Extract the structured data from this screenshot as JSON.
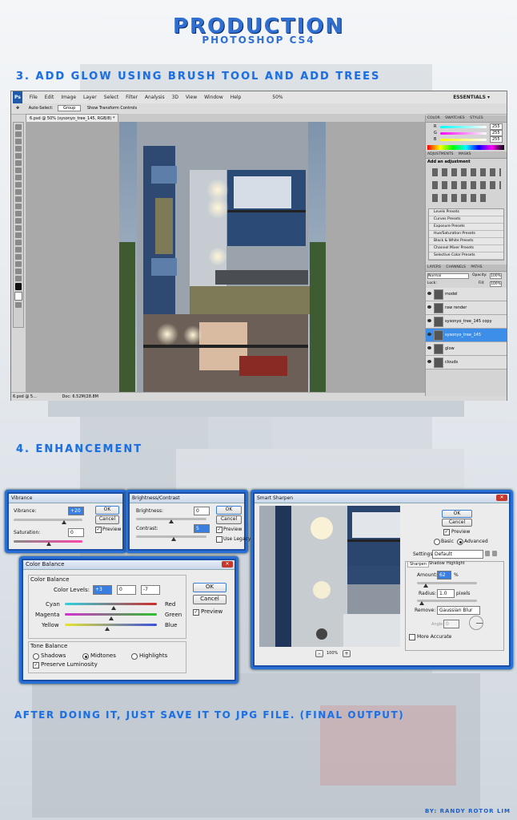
{
  "header": {
    "title": "PRODUCTION",
    "subtitle": "PHOTOSHOP CS4"
  },
  "steps": {
    "step3": "3. ADD GLOW USING BRUSH TOOL AND ADD TREES",
    "step4": "4. ENHANCEMENT",
    "final": "AFTER DOING IT, JUST SAVE IT TO JPG FILE. (FINAL OUTPUT)",
    "credit": "BY: RANDY ROTOR LIM"
  },
  "photoshop": {
    "logo": "Ps",
    "menu": [
      "File",
      "Edit",
      "Image",
      "Layer",
      "Select",
      "Filter",
      "Analysis",
      "3D",
      "View",
      "Window",
      "Help"
    ],
    "zoom": "50%",
    "workspace": "ESSENTIALS ▾",
    "options": {
      "auto_select": "Auto-Select:",
      "group": "Group",
      "transform": "Show Transform Controls"
    },
    "doc_tab": "6.psd @ 50% (sysonyo_tree_145, RGB/8) *",
    "status_left": "6.psd @ 5...",
    "status_doc": "Doc: 6.52M/28.8M",
    "color_panel": {
      "tabs": [
        "COLOR",
        "SWATCHES",
        "STYLES"
      ],
      "r_label": "R",
      "g_label": "G",
      "b_label": "B",
      "r": "255",
      "g": "255",
      "b": "255"
    },
    "adjustments": {
      "tabs": [
        "ADJUSTMENTS",
        "MASKS"
      ],
      "heading": "Add an adjustment",
      "presets": [
        "Levels Presets",
        "Curves Presets",
        "Exposure Presets",
        "Hue/Saturation Presets",
        "Black & White Presets",
        "Channel Mixer Presets",
        "Selective Color Presets"
      ]
    },
    "layers": {
      "tabs": [
        "LAYERS",
        "CHANNELS",
        "PATHS"
      ],
      "blend": "Normal",
      "opacity_label": "Opacity:",
      "opacity": "100%",
      "lock_label": "Lock:",
      "fill_label": "Fill:",
      "fill": "100%",
      "items": [
        {
          "name": "model",
          "selected": false
        },
        {
          "name": "raw render",
          "selected": false
        },
        {
          "name": "sysonyo_tree_145 copy",
          "selected": false
        },
        {
          "name": "sysonyo_tree_145",
          "selected": true
        },
        {
          "name": "glow",
          "selected": false
        },
        {
          "name": "clouds",
          "selected": false
        }
      ]
    }
  },
  "vibrance": {
    "title": "Vibrance",
    "vibrance_label": "Vibrance:",
    "vibrance_value": "+20",
    "saturation_label": "Saturation:",
    "saturation_value": "0",
    "ok": "OK",
    "cancel": "Cancel",
    "preview": "Preview"
  },
  "brightness": {
    "title": "Brightness/Contrast",
    "brightness_label": "Brightness:",
    "brightness_value": "0",
    "contrast_label": "Contrast:",
    "contrast_value": "5",
    "ok": "OK",
    "cancel": "Cancel",
    "preview": "Preview",
    "legacy": "Use Legacy"
  },
  "color_balance": {
    "title": "Color Balance",
    "group1": "Color Balance",
    "levels_label": "Color Levels:",
    "levels": [
      "+3",
      "0",
      "-7"
    ],
    "cyan": "Cyan",
    "red": "Red",
    "magenta": "Magenta",
    "green": "Green",
    "yellow": "Yellow",
    "blue": "Blue",
    "group2": "Tone Balance",
    "shadows": "Shadows",
    "midtones": "Midtones",
    "highlights": "Highlights",
    "preserve": "Preserve Luminosity",
    "ok": "OK",
    "cancel": "Cancel",
    "preview": "Preview",
    "slider_positions": [
      0.53,
      0.5,
      0.46
    ]
  },
  "smart_sharpen": {
    "title": "Smart Sharpen",
    "ok": "OK",
    "cancel": "Cancel",
    "preview": "Preview",
    "basic": "Basic",
    "advanced": "Advanced",
    "settings_label": "Settings:",
    "settings_value": "Default",
    "tabs": [
      "Sharpen",
      "Shadow",
      "Highlight"
    ],
    "amount_label": "Amount:",
    "amount_value": "62",
    "amount_unit": "%",
    "radius_label": "Radius:",
    "radius_value": "1.0",
    "radius_unit": "pixels",
    "remove_label": "Remove:",
    "remove_value": "Gaussian Blur",
    "angle_label": "Angle:",
    "angle_value": "0",
    "more_accurate": "More Accurate",
    "zoom": "100%"
  }
}
